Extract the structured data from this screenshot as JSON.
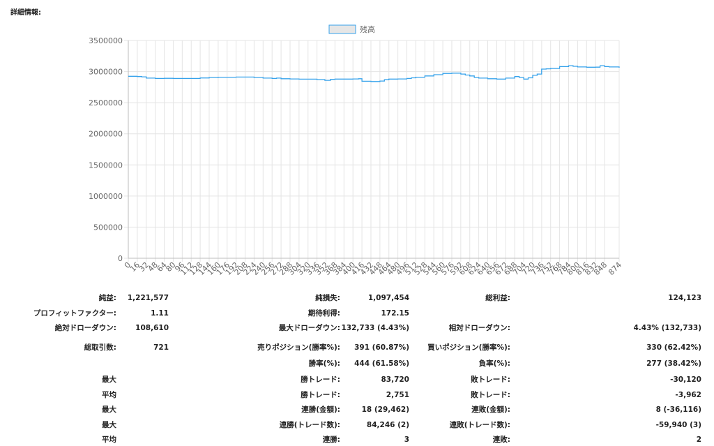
{
  "heading": "詳細情報:",
  "chart_data": {
    "type": "line",
    "series": [
      {
        "name": "残高",
        "color": "#36a2eb",
        "points": [
          [
            0,
            2925000
          ],
          [
            16,
            2920000
          ],
          [
            24,
            2915000
          ],
          [
            32,
            2895000
          ],
          [
            48,
            2890000
          ],
          [
            64,
            2892000
          ],
          [
            80,
            2890000
          ],
          [
            96,
            2890000
          ],
          [
            112,
            2890000
          ],
          [
            128,
            2898000
          ],
          [
            144,
            2905000
          ],
          [
            160,
            2910000
          ],
          [
            176,
            2910000
          ],
          [
            192,
            2912000
          ],
          [
            208,
            2912000
          ],
          [
            224,
            2905000
          ],
          [
            240,
            2895000
          ],
          [
            256,
            2890000
          ],
          [
            264,
            2895000
          ],
          [
            272,
            2885000
          ],
          [
            288,
            2882000
          ],
          [
            304,
            2878000
          ],
          [
            320,
            2878000
          ],
          [
            336,
            2872000
          ],
          [
            350,
            2860000
          ],
          [
            360,
            2875000
          ],
          [
            368,
            2880000
          ],
          [
            384,
            2880000
          ],
          [
            400,
            2882000
          ],
          [
            410,
            2885000
          ],
          [
            416,
            2845000
          ],
          [
            432,
            2840000
          ],
          [
            448,
            2848000
          ],
          [
            456,
            2870000
          ],
          [
            464,
            2880000
          ],
          [
            480,
            2882000
          ],
          [
            496,
            2890000
          ],
          [
            504,
            2900000
          ],
          [
            512,
            2910000
          ],
          [
            528,
            2930000
          ],
          [
            544,
            2950000
          ],
          [
            560,
            2970000
          ],
          [
            576,
            2975000
          ],
          [
            592,
            2960000
          ],
          [
            600,
            2945000
          ],
          [
            608,
            2930000
          ],
          [
            616,
            2905000
          ],
          [
            624,
            2895000
          ],
          [
            640,
            2885000
          ],
          [
            656,
            2880000
          ],
          [
            672,
            2895000
          ],
          [
            688,
            2920000
          ],
          [
            696,
            2905000
          ],
          [
            704,
            2880000
          ],
          [
            712,
            2900000
          ],
          [
            720,
            2940000
          ],
          [
            728,
            2960000
          ],
          [
            736,
            3040000
          ],
          [
            744,
            3045000
          ],
          [
            752,
            3050000
          ],
          [
            768,
            3080000
          ],
          [
            784,
            3095000
          ],
          [
            792,
            3085000
          ],
          [
            800,
            3075000
          ],
          [
            816,
            3070000
          ],
          [
            832,
            3072000
          ],
          [
            840,
            3095000
          ],
          [
            848,
            3080000
          ],
          [
            856,
            3075000
          ],
          [
            866,
            3075000
          ],
          [
            874,
            3062000
          ]
        ]
      }
    ],
    "y_ticks": [
      "0",
      "500000",
      "1000000",
      "1500000",
      "2000000",
      "2500000",
      "3000000",
      "3500000"
    ],
    "x_ticks": [
      "0",
      "16",
      "32",
      "48",
      "64",
      "80",
      "96",
      "112",
      "128",
      "144",
      "160",
      "176",
      "192",
      "208",
      "224",
      "240",
      "256",
      "272",
      "288",
      "304",
      "320",
      "336",
      "352",
      "368",
      "384",
      "400",
      "416",
      "432",
      "448",
      "464",
      "480",
      "496",
      "512",
      "528",
      "544",
      "560",
      "576",
      "592",
      "608",
      "624",
      "640",
      "656",
      "672",
      "688",
      "704",
      "720",
      "736",
      "752",
      "768",
      "784",
      "800",
      "816",
      "832",
      "848",
      "874"
    ],
    "xlim": [
      0,
      874
    ],
    "ylim": [
      0,
      3500000
    ],
    "grid": true,
    "legend": "top-center"
  },
  "stats": {
    "row1": {
      "label1": "純益:",
      "value1": "1,221,577",
      "label2": "純損失:",
      "value2": "1,097,454",
      "label3": "総利益:",
      "value3": "124,123"
    },
    "row2": {
      "label1": "プロフィットファクター:",
      "value1": "1.11",
      "label2": "期待利得:",
      "value2": "172.15"
    },
    "row3": {
      "label1": "絶対ドローダウン:",
      "value1": "108,610",
      "label2": "最大ドローダウン:",
      "value2": "132,733 (4.43%)",
      "label3": "相対ドローダウン:",
      "value3": "4.43% (132,733)"
    },
    "row4": {
      "label1": "総取引数:",
      "value1": "721",
      "label2": "売りポジション(勝率%):",
      "value2": "391 (60.87%)",
      "label3": "買いポジション(勝率%):",
      "value3": "330 (62.42%)"
    },
    "row5": {
      "label2": "勝率(%):",
      "value2": "444 (61.58%)",
      "label3": "負率(%):",
      "value3": "277 (38.42%)"
    },
    "row6": {
      "label1": "最大",
      "label2": "勝トレード:",
      "value2": "83,720",
      "label3": "敗トレード:",
      "value3": "-30,120"
    },
    "row7": {
      "label1": "平均",
      "label2": "勝トレード:",
      "value2": "2,751",
      "label3": "敗トレード:",
      "value3": "-3,962"
    },
    "row8": {
      "label1": "最大",
      "label2": "連勝(金額):",
      "value2": "18 (29,462)",
      "label3": "連敗(金額):",
      "value3": "8 (-36,116)"
    },
    "row9": {
      "label1": "最大",
      "label2": "連勝(トレード数):",
      "value2": "84,246 (2)",
      "label3": "連敗(トレード数):",
      "value3": "-59,940 (3)"
    },
    "row10": {
      "label1": "平均",
      "label2": "連勝:",
      "value2": "3",
      "label3": "連敗:",
      "value3": "2"
    }
  }
}
